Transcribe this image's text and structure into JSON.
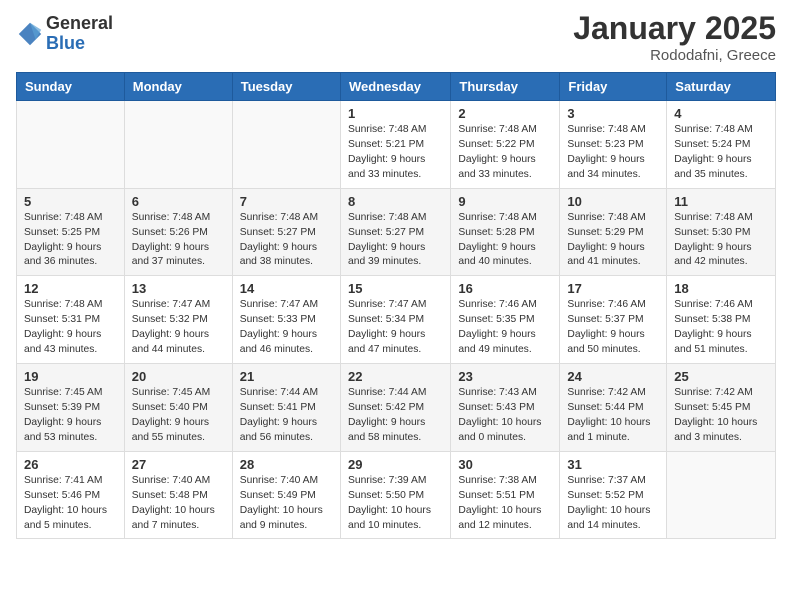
{
  "header": {
    "logo_general": "General",
    "logo_blue": "Blue",
    "month": "January 2025",
    "location": "Rododafni, Greece"
  },
  "days_of_week": [
    "Sunday",
    "Monday",
    "Tuesday",
    "Wednesday",
    "Thursday",
    "Friday",
    "Saturday"
  ],
  "weeks": [
    [
      {
        "day": "",
        "info": ""
      },
      {
        "day": "",
        "info": ""
      },
      {
        "day": "",
        "info": ""
      },
      {
        "day": "1",
        "info": "Sunrise: 7:48 AM\nSunset: 5:21 PM\nDaylight: 9 hours and 33 minutes."
      },
      {
        "day": "2",
        "info": "Sunrise: 7:48 AM\nSunset: 5:22 PM\nDaylight: 9 hours and 33 minutes."
      },
      {
        "day": "3",
        "info": "Sunrise: 7:48 AM\nSunset: 5:23 PM\nDaylight: 9 hours and 34 minutes."
      },
      {
        "day": "4",
        "info": "Sunrise: 7:48 AM\nSunset: 5:24 PM\nDaylight: 9 hours and 35 minutes."
      }
    ],
    [
      {
        "day": "5",
        "info": "Sunrise: 7:48 AM\nSunset: 5:25 PM\nDaylight: 9 hours and 36 minutes."
      },
      {
        "day": "6",
        "info": "Sunrise: 7:48 AM\nSunset: 5:26 PM\nDaylight: 9 hours and 37 minutes."
      },
      {
        "day": "7",
        "info": "Sunrise: 7:48 AM\nSunset: 5:27 PM\nDaylight: 9 hours and 38 minutes."
      },
      {
        "day": "8",
        "info": "Sunrise: 7:48 AM\nSunset: 5:27 PM\nDaylight: 9 hours and 39 minutes."
      },
      {
        "day": "9",
        "info": "Sunrise: 7:48 AM\nSunset: 5:28 PM\nDaylight: 9 hours and 40 minutes."
      },
      {
        "day": "10",
        "info": "Sunrise: 7:48 AM\nSunset: 5:29 PM\nDaylight: 9 hours and 41 minutes."
      },
      {
        "day": "11",
        "info": "Sunrise: 7:48 AM\nSunset: 5:30 PM\nDaylight: 9 hours and 42 minutes."
      }
    ],
    [
      {
        "day": "12",
        "info": "Sunrise: 7:48 AM\nSunset: 5:31 PM\nDaylight: 9 hours and 43 minutes."
      },
      {
        "day": "13",
        "info": "Sunrise: 7:47 AM\nSunset: 5:32 PM\nDaylight: 9 hours and 44 minutes."
      },
      {
        "day": "14",
        "info": "Sunrise: 7:47 AM\nSunset: 5:33 PM\nDaylight: 9 hours and 46 minutes."
      },
      {
        "day": "15",
        "info": "Sunrise: 7:47 AM\nSunset: 5:34 PM\nDaylight: 9 hours and 47 minutes."
      },
      {
        "day": "16",
        "info": "Sunrise: 7:46 AM\nSunset: 5:35 PM\nDaylight: 9 hours and 49 minutes."
      },
      {
        "day": "17",
        "info": "Sunrise: 7:46 AM\nSunset: 5:37 PM\nDaylight: 9 hours and 50 minutes."
      },
      {
        "day": "18",
        "info": "Sunrise: 7:46 AM\nSunset: 5:38 PM\nDaylight: 9 hours and 51 minutes."
      }
    ],
    [
      {
        "day": "19",
        "info": "Sunrise: 7:45 AM\nSunset: 5:39 PM\nDaylight: 9 hours and 53 minutes."
      },
      {
        "day": "20",
        "info": "Sunrise: 7:45 AM\nSunset: 5:40 PM\nDaylight: 9 hours and 55 minutes."
      },
      {
        "day": "21",
        "info": "Sunrise: 7:44 AM\nSunset: 5:41 PM\nDaylight: 9 hours and 56 minutes."
      },
      {
        "day": "22",
        "info": "Sunrise: 7:44 AM\nSunset: 5:42 PM\nDaylight: 9 hours and 58 minutes."
      },
      {
        "day": "23",
        "info": "Sunrise: 7:43 AM\nSunset: 5:43 PM\nDaylight: 10 hours and 0 minutes."
      },
      {
        "day": "24",
        "info": "Sunrise: 7:42 AM\nSunset: 5:44 PM\nDaylight: 10 hours and 1 minute."
      },
      {
        "day": "25",
        "info": "Sunrise: 7:42 AM\nSunset: 5:45 PM\nDaylight: 10 hours and 3 minutes."
      }
    ],
    [
      {
        "day": "26",
        "info": "Sunrise: 7:41 AM\nSunset: 5:46 PM\nDaylight: 10 hours and 5 minutes."
      },
      {
        "day": "27",
        "info": "Sunrise: 7:40 AM\nSunset: 5:48 PM\nDaylight: 10 hours and 7 minutes."
      },
      {
        "day": "28",
        "info": "Sunrise: 7:40 AM\nSunset: 5:49 PM\nDaylight: 10 hours and 9 minutes."
      },
      {
        "day": "29",
        "info": "Sunrise: 7:39 AM\nSunset: 5:50 PM\nDaylight: 10 hours and 10 minutes."
      },
      {
        "day": "30",
        "info": "Sunrise: 7:38 AM\nSunset: 5:51 PM\nDaylight: 10 hours and 12 minutes."
      },
      {
        "day": "31",
        "info": "Sunrise: 7:37 AM\nSunset: 5:52 PM\nDaylight: 10 hours and 14 minutes."
      },
      {
        "day": "",
        "info": ""
      }
    ]
  ]
}
